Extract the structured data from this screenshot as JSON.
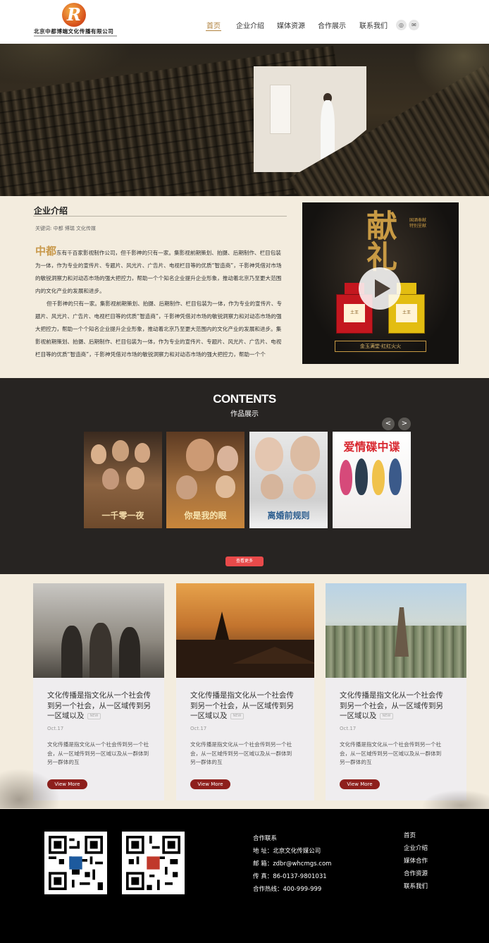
{
  "header": {
    "company_name": "北京中都博端文化传播有限公司",
    "logo_letter": "R",
    "nav": [
      "首页",
      "企业介绍",
      "媒体资源",
      "合作展示",
      "联系我们"
    ],
    "active_nav": "首页",
    "social": [
      {
        "icon": "weibo-icon",
        "glyph": "◎"
      },
      {
        "icon": "wechat-icon",
        "glyph": "✉"
      }
    ]
  },
  "intro": {
    "title": "企业介绍",
    "keywords": "关键词: 中都 博瑞 文化传媒",
    "lead": "中都",
    "p1": "东有千百家影视制作公司，但千影神的只有一家。集影视前期策划、拍摄、后期制作、栏目包装为一体，作为专业的宣传片、专题片、风光片、广告片、电视栏目等的优质“智造商”，千影神凭借对市场的敏锐洞察力和对动态市场的强大把控力，帮助一个个知名企业提升企业形象，推动着北京乃至更大范围内的文化产业的发展和进步。",
    "p2": "但千影神的只有一家。集影视前期策划、拍摄、后期制作、栏目包装为一体，作为专业的宣传片、专题片、风光片、广告片、电视栏目等的优质“智造商”，千影神凭借对市场的敏锐洞察力和对动态市场的强大把控力，帮助一个个知名企业提升企业形象，推动着北京乃至更大范围内的文化产业的发展和进步。集影视前期策划、拍摄、后期制作、栏目包装为一体，作为专业的宣传片、专题片、风光片、广告片、电视栏目等的优质“智造商”，千影神凭借对市场的敏锐洞察力和对动态市场的强大把控力，帮助一个个"
  },
  "promo": {
    "big_char": "献礼",
    "side_text": "国酒奉献 特别呈献",
    "bottle_label": "土王",
    "slogan": "金玉满堂·红红火火"
  },
  "contents": {
    "title": "CONTENTS",
    "subtitle": "作品展示",
    "prev": "<",
    "next": ">",
    "posters": [
      {
        "title": "一千零一夜",
        "bg": "#6e4a2c",
        "color": "#f1d9a8"
      },
      {
        "title": "你是我的眼",
        "bg": "#8a5a2e",
        "color": "#f8e7b3"
      },
      {
        "title": "离婚前规则",
        "bg": "#dcdcdc",
        "color": "#2a5c8e"
      },
      {
        "title": "爱情碟中谍",
        "bg": "#f3f1f0",
        "color": "#d8262e"
      }
    ],
    "more_button": "查看更多"
  },
  "cards": [
    {
      "title": "文化传播是指文化从一个社会传到另一个社会，从一区域传到另一区域以及",
      "badge": "NEW",
      "date": "Oct.17",
      "desc": "文化传播是指文化从一个社会传到另一个社会，从一区域传到另一区域以及从一群体到另一群体的互",
      "button": "View More"
    },
    {
      "title": "文化传播是指文化从一个社会传到另一个社会，从一区域传到另一区域以及",
      "badge": "NEW",
      "date": "Oct.17",
      "desc": "文化传播是指文化从一个社会传到另一个社会，从一区域传到另一区域以及从一群体到另一群体的互",
      "button": "View More"
    },
    {
      "title": "文化传播是指文化从一个社会传到另一个社会，从一区域传到另一区域以及",
      "badge": "NEW",
      "date": "Oct.17",
      "desc": "文化传播是指文化从一个社会传到另一个社会，从一区域传到另一区域以及从一群体到另一群体的互",
      "button": "View More"
    }
  ],
  "footer": {
    "contact": [
      "合作联系",
      "地 址：北京文化传媒公司",
      "邮 箱：zdbr@whcmgs.com",
      "传 真：86-0137-9801031",
      "合作热线：400-999-999"
    ],
    "links": [
      "首页",
      "企业介绍",
      "媒体合作",
      "合作资源",
      "联系我们"
    ]
  },
  "colors": {
    "accent_gold": "#b0813d",
    "dark_section": "#272422",
    "more_red": "#e84a4a",
    "view_more": "#8e1f1c",
    "page_bg": "#f3ecde"
  }
}
